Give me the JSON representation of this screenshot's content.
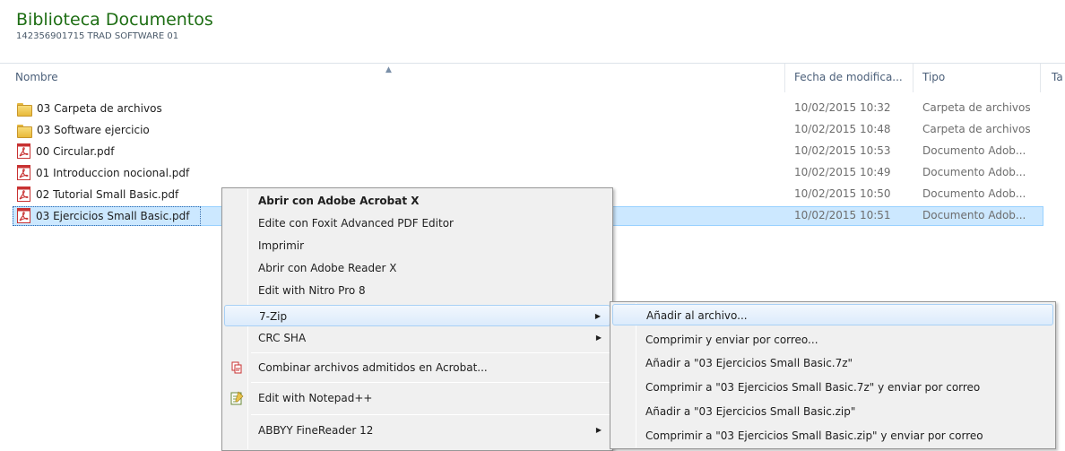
{
  "library": {
    "title": "Biblioteca Documentos",
    "subtitle": "142356901715 TRAD SOFTWARE 01"
  },
  "columns": {
    "name": "Nombre",
    "date": "Fecha de modifica...",
    "type": "Tipo",
    "size": "Ta"
  },
  "files": [
    {
      "name": "03 Carpeta de archivos",
      "date": "10/02/2015 10:32",
      "type": "Carpeta de archivos",
      "icon": "folder-icon"
    },
    {
      "name": "03 Software ejercicio",
      "date": "10/02/2015 10:48",
      "type": "Carpeta de archivos",
      "icon": "folder-icon"
    },
    {
      "name": "00 Circular.pdf",
      "date": "10/02/2015 10:53",
      "type": "Documento Adob...",
      "icon": "pdf-icon"
    },
    {
      "name": "01 Introduccion nocional.pdf",
      "date": "10/02/2015 10:49",
      "type": "Documento Adob...",
      "icon": "pdf-icon"
    },
    {
      "name": "02 Tutorial Small Basic.pdf",
      "date": "10/02/2015 10:50",
      "type": "Documento Adob...",
      "icon": "pdf-icon"
    },
    {
      "name": "03 Ejercicios Small Basic.pdf",
      "date": "10/02/2015 10:51",
      "type": "Documento Adob...",
      "icon": "pdf-icon",
      "selected": true
    }
  ],
  "context_menu": {
    "items": [
      {
        "label": "Abrir con Adobe Acrobat X",
        "bold": true
      },
      {
        "label": "Edite con Foxit Advanced PDF Editor"
      },
      {
        "label": "Imprimir"
      },
      {
        "label": "Abrir con Adobe Reader X"
      },
      {
        "label": "Edit with Nitro Pro 8"
      },
      {
        "label": "7-Zip",
        "submenu": true,
        "highlighted": true
      },
      {
        "label": "CRC SHA",
        "submenu": true
      },
      {
        "label": "Combinar archivos admitidos en Acrobat...",
        "icon": "acrobat-combine-icon"
      },
      {
        "label": "Edit with Notepad++",
        "icon": "notepad-plus-plus-icon"
      },
      {
        "label": "ABBYY FineReader 12",
        "submenu": true
      }
    ],
    "arrow_glyph": "▶"
  },
  "submenu_7zip": {
    "items": [
      {
        "label": "Añadir al archivo...",
        "highlighted": true
      },
      {
        "label": "Comprimir y enviar por correo..."
      },
      {
        "label": "Añadir a \"03 Ejercicios Small Basic.7z\""
      },
      {
        "label": "Comprimir a \"03 Ejercicios Small Basic.7z\" y enviar por correo"
      },
      {
        "label": "Añadir a \"03 Ejercicios Small Basic.zip\""
      },
      {
        "label": "Comprimir a \"03 Ejercicios Small Basic.zip\" y enviar por correo"
      }
    ]
  },
  "colors": {
    "title_green": "#1e6e14",
    "selection_bg": "#cce8ff",
    "menu_bg": "#f0f0f0",
    "menu_highlight_border": "#a8d0f5"
  }
}
